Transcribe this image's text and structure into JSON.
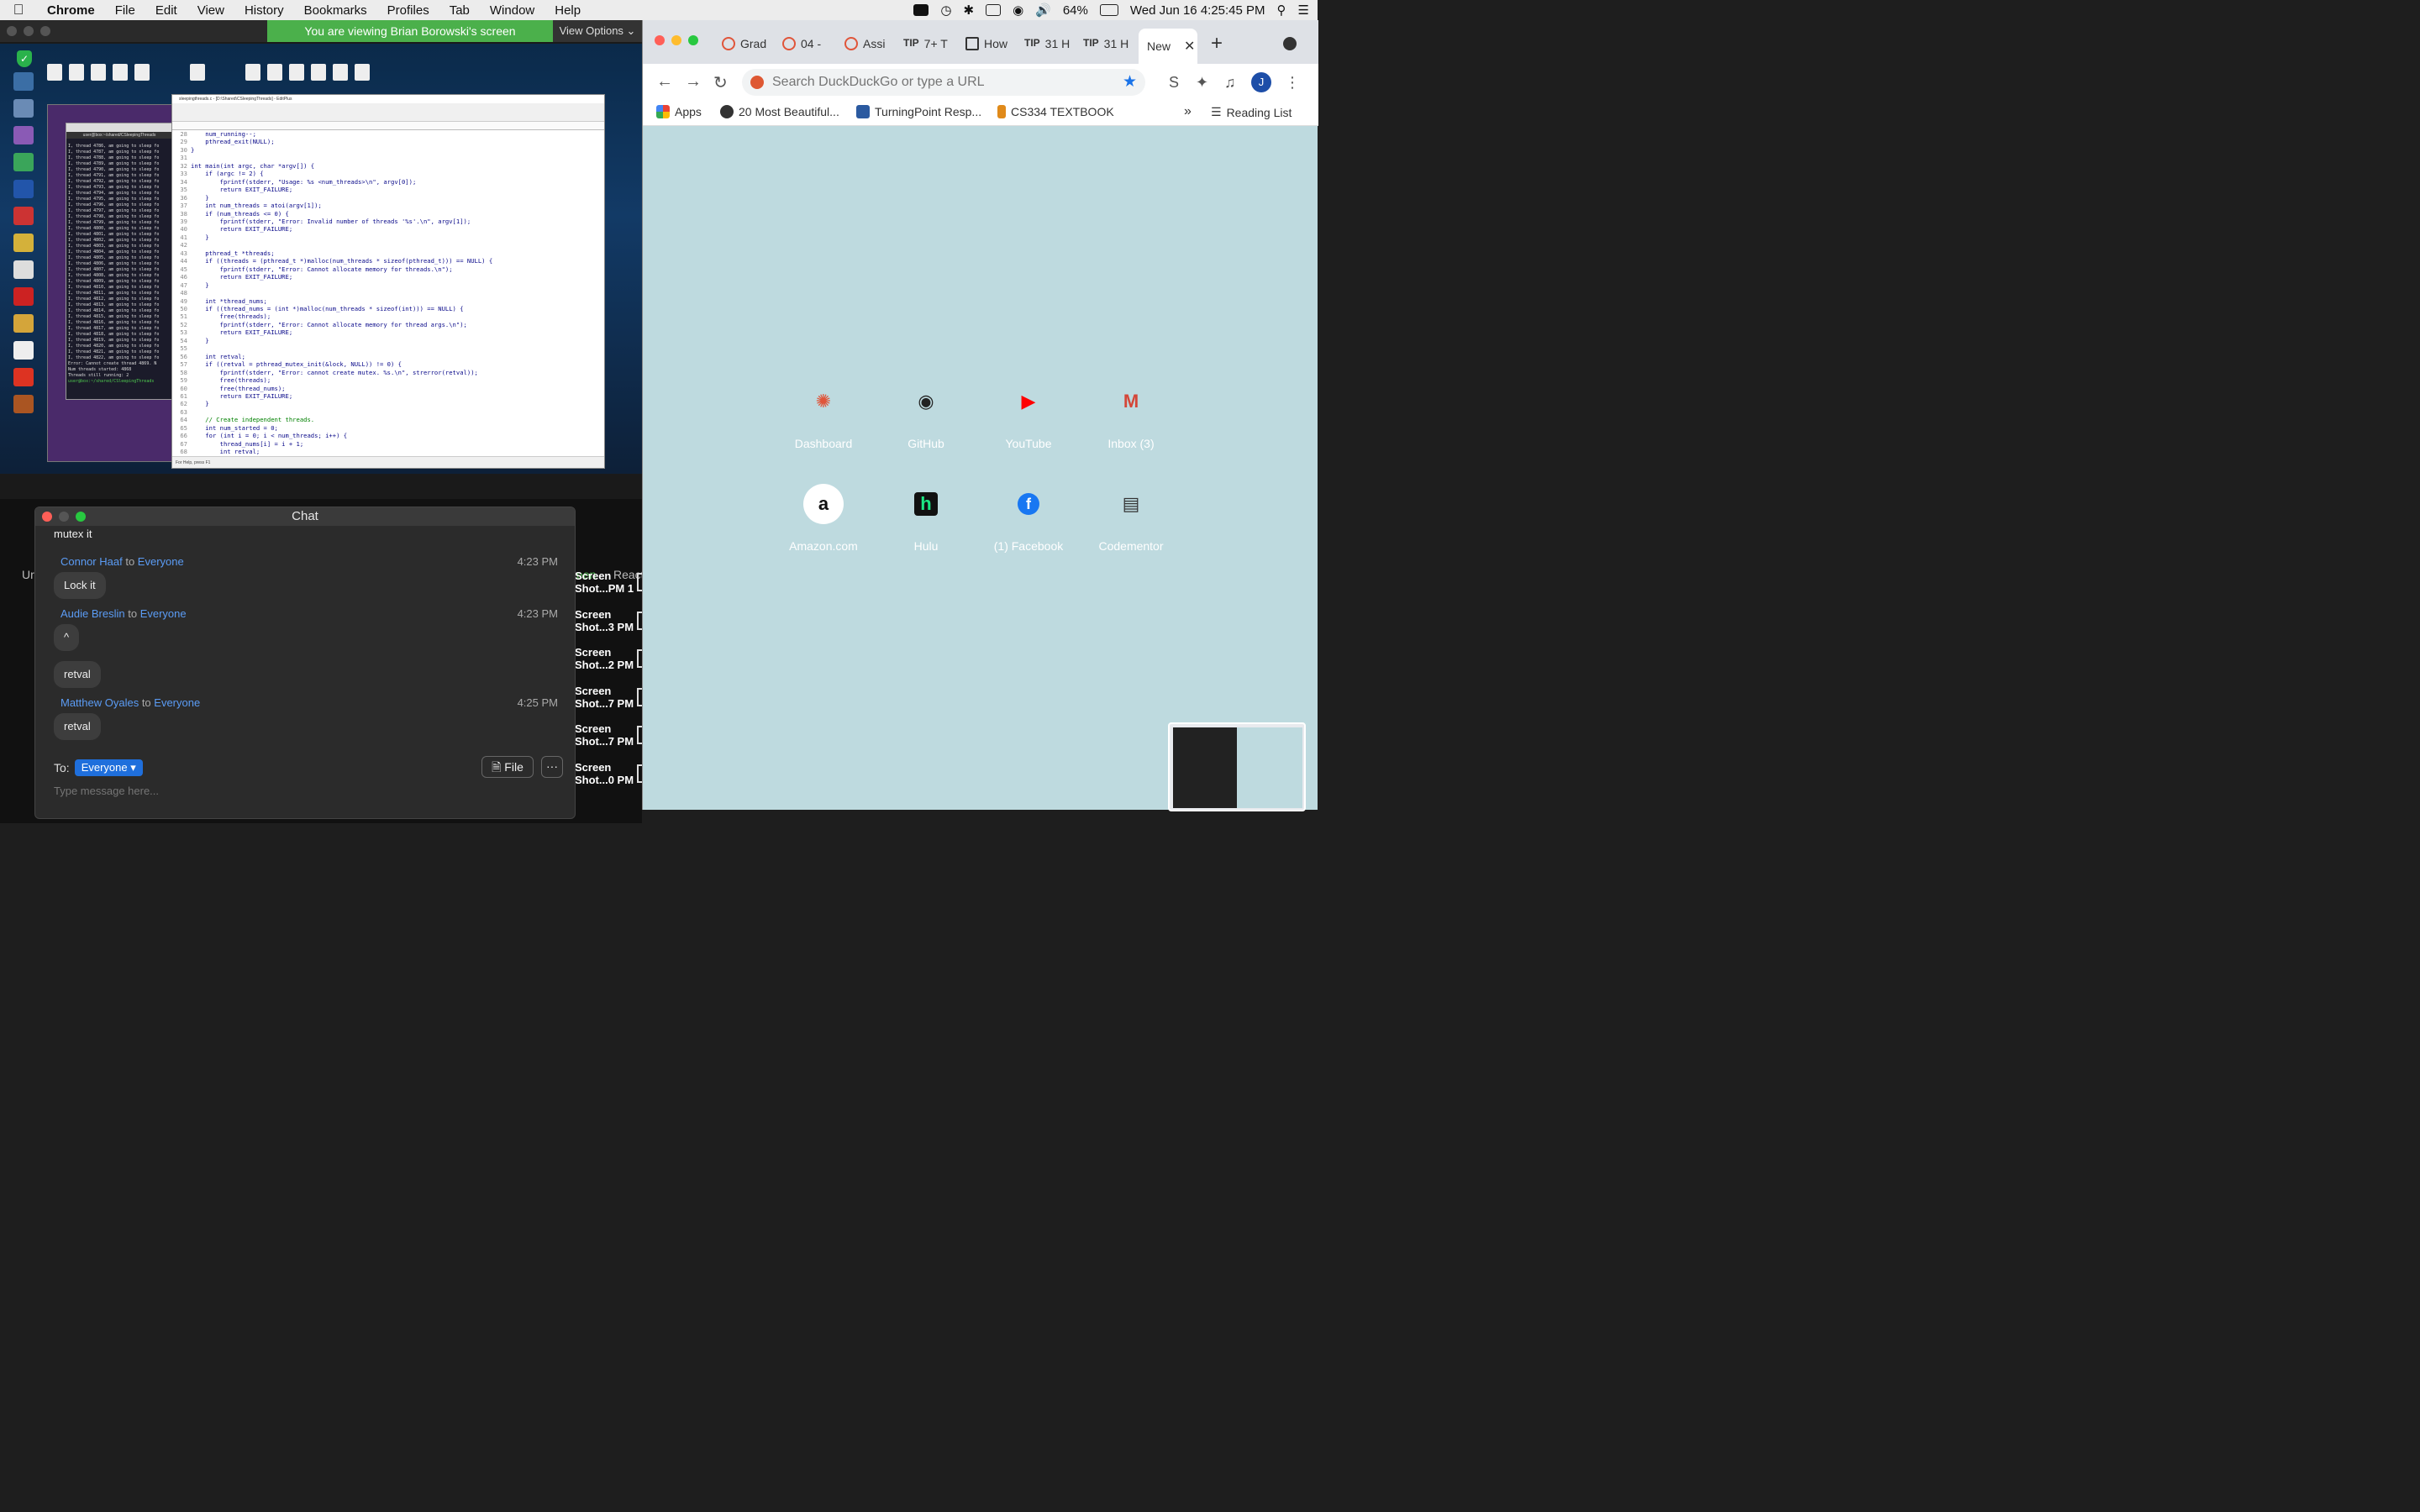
{
  "menubar": {
    "app": "Chrome",
    "items": [
      "File",
      "Edit",
      "View",
      "History",
      "Bookmarks",
      "Profiles",
      "Tab",
      "Window",
      "Help"
    ],
    "battery": "64%",
    "datetime": "Wed Jun 16  4:25:45 PM"
  },
  "zoom": {
    "share_banner": "You are viewing Brian Borowski's screen",
    "view_options": "View Options ⌄",
    "side_labels": {
      "unmute": "Ur",
      "reactions": "React",
      "record": "een"
    }
  },
  "editor": {
    "title": "sleepingthreads.c - [D:\\Shared\\CSleepingThreads] - EditPlus",
    "status": "For Help, press F1",
    "lines": [
      {
        "n": "28",
        "t": "    num_running--;"
      },
      {
        "n": "29",
        "t": "    pthread_exit(NULL);"
      },
      {
        "n": "30",
        "t": "}"
      },
      {
        "n": "31",
        "t": ""
      },
      {
        "n": "32",
        "t": "int main(int argc, char *argv[]) {"
      },
      {
        "n": "33",
        "t": "    if (argc != 2) {"
      },
      {
        "n": "34",
        "t": "        fprintf(stderr, \"Usage: %s <num_threads>\\n\", argv[0]);"
      },
      {
        "n": "35",
        "t": "        return EXIT_FAILURE;"
      },
      {
        "n": "36",
        "t": "    }"
      },
      {
        "n": "37",
        "t": "    int num_threads = atoi(argv[1]);"
      },
      {
        "n": "38",
        "t": "    if (num_threads <= 0) {"
      },
      {
        "n": "39",
        "t": "        fprintf(stderr, \"Error: Invalid number of threads '%s'.\\n\", argv[1]);"
      },
      {
        "n": "40",
        "t": "        return EXIT_FAILURE;"
      },
      {
        "n": "41",
        "t": "    }"
      },
      {
        "n": "42",
        "t": ""
      },
      {
        "n": "43",
        "t": "    pthread_t *threads;"
      },
      {
        "n": "44",
        "t": "    if ((threads = (pthread_t *)malloc(num_threads * sizeof(pthread_t))) == NULL) {"
      },
      {
        "n": "45",
        "t": "        fprintf(stderr, \"Error: Cannot allocate memory for threads.\\n\");"
      },
      {
        "n": "46",
        "t": "        return EXIT_FAILURE;"
      },
      {
        "n": "47",
        "t": "    }"
      },
      {
        "n": "48",
        "t": ""
      },
      {
        "n": "49",
        "t": "    int *thread_nums;"
      },
      {
        "n": "50",
        "t": "    if ((thread_nums = (int *)malloc(num_threads * sizeof(int))) == NULL) {"
      },
      {
        "n": "51",
        "t": "        free(threads);"
      },
      {
        "n": "52",
        "t": "        fprintf(stderr, \"Error: Cannot allocate memory for thread args.\\n\");"
      },
      {
        "n": "53",
        "t": "        return EXIT_FAILURE;"
      },
      {
        "n": "54",
        "t": "    }"
      },
      {
        "n": "55",
        "t": ""
      },
      {
        "n": "56",
        "t": "    int retval;"
      },
      {
        "n": "57",
        "t": "    if ((retval = pthread_mutex_init(&lock, NULL)) != 0) {"
      },
      {
        "n": "58",
        "t": "        fprintf(stderr, \"Error: cannot create mutex. %s.\\n\", strerror(retval));"
      },
      {
        "n": "59",
        "t": "        free(threads);"
      },
      {
        "n": "60",
        "t": "        free(thread_nums);"
      },
      {
        "n": "61",
        "t": "        return EXIT_FAILURE;"
      },
      {
        "n": "62",
        "t": "    }"
      },
      {
        "n": "63",
        "t": ""
      },
      {
        "n": "64",
        "t": "    // Create independent threads."
      },
      {
        "n": "65",
        "t": "    int num_started = 0;"
      },
      {
        "n": "66",
        "t": "    for (int i = 0; i < num_threads; i++) {"
      },
      {
        "n": "67",
        "t": "        thread_nums[i] = i + 1;"
      },
      {
        "n": "68",
        "t": "        int retval;"
      },
      {
        "n": "69",
        "t": "        if ((retval = pthread_create(&threads[i], NULL, sleep_print,"
      }
    ]
  },
  "terminal": {
    "prompt": "user@box:~/shared/CSleepingThreads",
    "lines": [
      "I, thread 4786, am going to sleep fo",
      "I, thread 4787, am going to sleep fo",
      "I, thread 4788, am going to sleep fo",
      "I, thread 4789, am going to sleep fo",
      "I, thread 4790, am going to sleep fo",
      "I, thread 4791, am going to sleep fo",
      "I, thread 4792, am going to sleep fo",
      "I, thread 4793, am going to sleep fo",
      "I, thread 4794, am going to sleep fo",
      "I, thread 4795, am going to sleep fo",
      "I, thread 4796, am going to sleep fo",
      "I, thread 4797, am going to sleep fo",
      "I, thread 4798, am going to sleep fo",
      "I, thread 4799, am going to sleep fo",
      "I, thread 4800, am going to sleep fo",
      "I, thread 4801, am going to sleep fo",
      "I, thread 4802, am going to sleep fo",
      "I, thread 4803, am going to sleep fo",
      "I, thread 4804, am going to sleep fo",
      "I, thread 4805, am going to sleep fo",
      "I, thread 4806, am going to sleep fo",
      "I, thread 4807, am going to sleep fo",
      "I, thread 4808, am going to sleep fo",
      "I, thread 4809, am going to sleep fo",
      "I, thread 4810, am going to sleep fo",
      "I, thread 4811, am going to sleep fo",
      "I, thread 4812, am going to sleep fo",
      "I, thread 4813, am going to sleep fo",
      "I, thread 4814, am going to sleep fo",
      "I, thread 4815, am going to sleep fo",
      "I, thread 4816, am going to sleep fo",
      "I, thread 4817, am going to sleep fo",
      "I, thread 4818, am going to sleep fo",
      "I, thread 4819, am going to sleep fo",
      "I, thread 4820, am going to sleep fo",
      "I, thread 4821, am going to sleep fo",
      "I, thread 4822, am going to sleep fo",
      "Error: Cannot create thread 4869. N",
      "Num threads started: 4868",
      "Threads still running: 2"
    ]
  },
  "chat": {
    "title": "Chat",
    "messages": [
      {
        "text": "mutex it"
      },
      {
        "sender": "Connor Haaf",
        "to_word": " to ",
        "to": "Everyone",
        "time": "4:23 PM",
        "text": "Lock it"
      },
      {
        "sender": "Audie Breslin",
        "to_word": " to ",
        "to": "Everyone",
        "time": "4:23 PM",
        "text": "^",
        "text2": "retval"
      },
      {
        "sender": "Matthew Oyales",
        "to_word": " to ",
        "to": "Everyone",
        "time": "4:25 PM",
        "text": "retval"
      }
    ],
    "to_label": "To:",
    "recipient": "Everyone",
    "file_button": "File",
    "more_button": "···",
    "input_placeholder": "Type message here..."
  },
  "desktop_files": [
    "Screen Shot...PM 1",
    "Screen Shot...3 PM",
    "Screen Shot...2 PM",
    "Screen Shot...7 PM",
    "Screen Shot...7 PM",
    "Screen Shot...0 PM"
  ],
  "chrome": {
    "tabs": [
      {
        "label": "Grad",
        "icon": "canvas"
      },
      {
        "label": "04 -",
        "icon": "canvas"
      },
      {
        "label": "Assi",
        "icon": "canvas"
      },
      {
        "label": "7+ T",
        "icon": "tip"
      },
      {
        "label": "How",
        "icon": "page"
      },
      {
        "label": "31 H",
        "icon": "tip"
      },
      {
        "label": "31 H",
        "icon": "tip"
      },
      {
        "label": "New",
        "icon": "none"
      }
    ],
    "tip_text": "TIP",
    "omnibox_placeholder": "Search DuckDuckGo or type a URL",
    "avatar_letter": "J",
    "bookmarks": [
      "Apps",
      "20 Most Beautiful...",
      "TurningPoint Resp...",
      "CS334 TEXTBOOK"
    ],
    "bookmarks_overflow": "»",
    "reading_list": "Reading List",
    "shortcuts": [
      {
        "label": "Dashboard",
        "glyph": "✺",
        "color": "#e0553a"
      },
      {
        "label": "GitHub",
        "glyph": "◉",
        "color": "#222222"
      },
      {
        "label": "YouTube",
        "glyph": "▶",
        "color": "#ff0000"
      },
      {
        "label": "Inbox (3)",
        "glyph": "M",
        "color": "#d44638"
      },
      {
        "label": "Amazon.com",
        "glyph": "a",
        "color": "#111111"
      },
      {
        "label": "Hulu",
        "glyph": "h",
        "color": "#1ce783"
      },
      {
        "label": "(1) Facebook",
        "glyph": "f",
        "color": "#1877f2"
      },
      {
        "label": "Codementor",
        "glyph": "▤",
        "color": "#333333"
      }
    ]
  }
}
